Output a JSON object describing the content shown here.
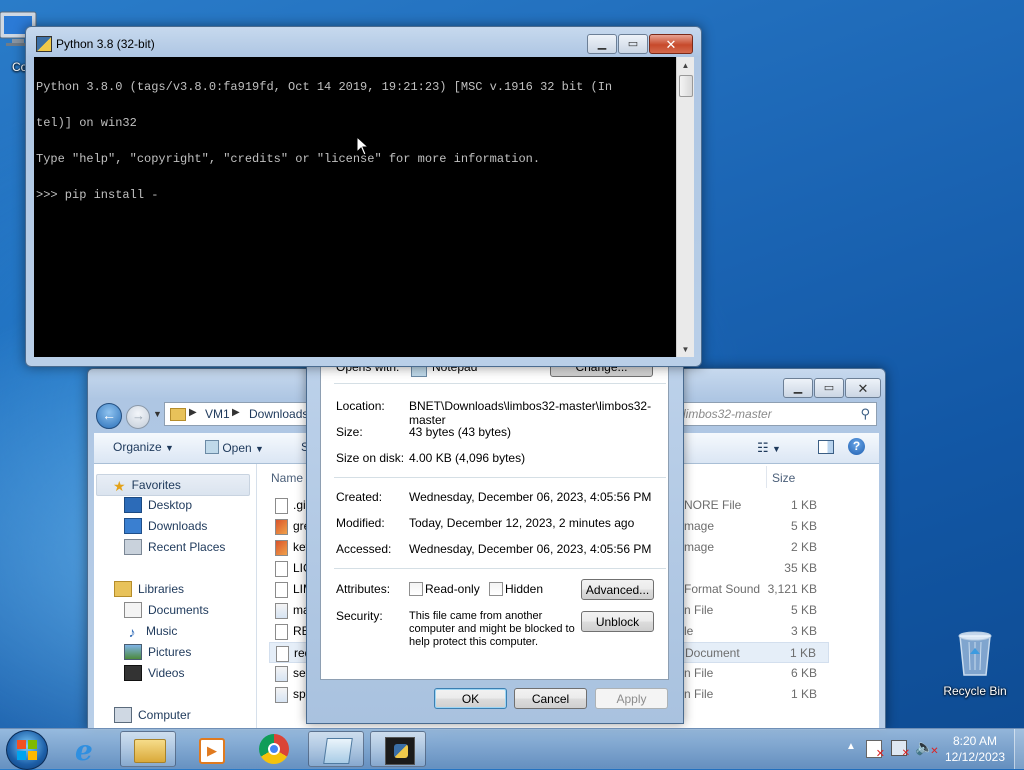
{
  "desktop": {
    "computer_label": "Co",
    "recycle_label": "Recycle Bin"
  },
  "console": {
    "title": "Python 3.8 (32-bit)",
    "lines": [
      "Python 3.8.0 (tags/v3.8.0:fa919fd, Oct 14 2019, 19:21:23) [MSC v.1916 32 bit (In",
      "tel)] on win32",
      "Type \"help\", \"copyright\", \"credits\" or \"license\" for more information.",
      ">>> pip install -"
    ]
  },
  "explorer": {
    "breadcrumb": [
      "VM1",
      "Downloads"
    ],
    "search_placeholder": "Search limbos32-master",
    "search_visible": "limbos32-master",
    "toolbar": {
      "organize": "Organize",
      "open": "Open",
      "share": "S"
    },
    "nav": {
      "favorites": "Favorites",
      "desktop": "Desktop",
      "downloads": "Downloads",
      "recent": "Recent Places",
      "libraries": "Libraries",
      "documents": "Documents",
      "music": "Music",
      "pictures": "Pictures",
      "videos": "Videos",
      "computer": "Computer"
    },
    "columns": {
      "name": "Name",
      "size": "Size"
    },
    "files": [
      {
        "name": ".gi",
        "type": "NORE File",
        "size": "1 KB"
      },
      {
        "name": "gre",
        "type": "mage",
        "size": "5 KB"
      },
      {
        "name": "key",
        "type": "mage",
        "size": "2 KB"
      },
      {
        "name": "LIC",
        "type": "",
        "size": "35 KB"
      },
      {
        "name": "LIM",
        "type": "Format Sound",
        "size": "3,121 KB"
      },
      {
        "name": "ma",
        "type": "n File",
        "size": "5 KB"
      },
      {
        "name": "RE",
        "type": "le",
        "size": "3 KB"
      },
      {
        "name": "req",
        "type": "Document",
        "size": "1 KB"
      },
      {
        "name": "ser",
        "type": "n File",
        "size": "6 KB"
      },
      {
        "name": "spa",
        "type": "n File",
        "size": "1 KB"
      }
    ]
  },
  "properties": {
    "opens_with_label": "Opens with:",
    "opens_with_value": "Notepad",
    "change_btn": "Change...",
    "location_label": "Location:",
    "location_value": "BNET\\Downloads\\limbos32-master\\limbos32-master",
    "size_label": "Size:",
    "size_value": "43 bytes (43 bytes)",
    "disk_label": "Size on disk:",
    "disk_value": "4.00 KB (4,096 bytes)",
    "created_label": "Created:",
    "created_value": "Wednesday, December 06, 2023, 4:05:56 PM",
    "modified_label": "Modified:",
    "modified_value": "Today, December 12, 2023, 2 minutes ago",
    "accessed_label": "Accessed:",
    "accessed_value": "Wednesday, December 06, 2023, 4:05:56 PM",
    "attributes_label": "Attributes:",
    "readonly_label": "Read-only",
    "hidden_label": "Hidden",
    "advanced_btn": "Advanced...",
    "security_label": "Security:",
    "security_text": "This file came from another computer and might be blocked to help protect this computer.",
    "unblock_btn": "Unblock",
    "ok_btn": "OK",
    "cancel_btn": "Cancel",
    "apply_btn": "Apply"
  },
  "taskbar": {
    "time": "8:20 AM",
    "date": "12/12/2023"
  }
}
